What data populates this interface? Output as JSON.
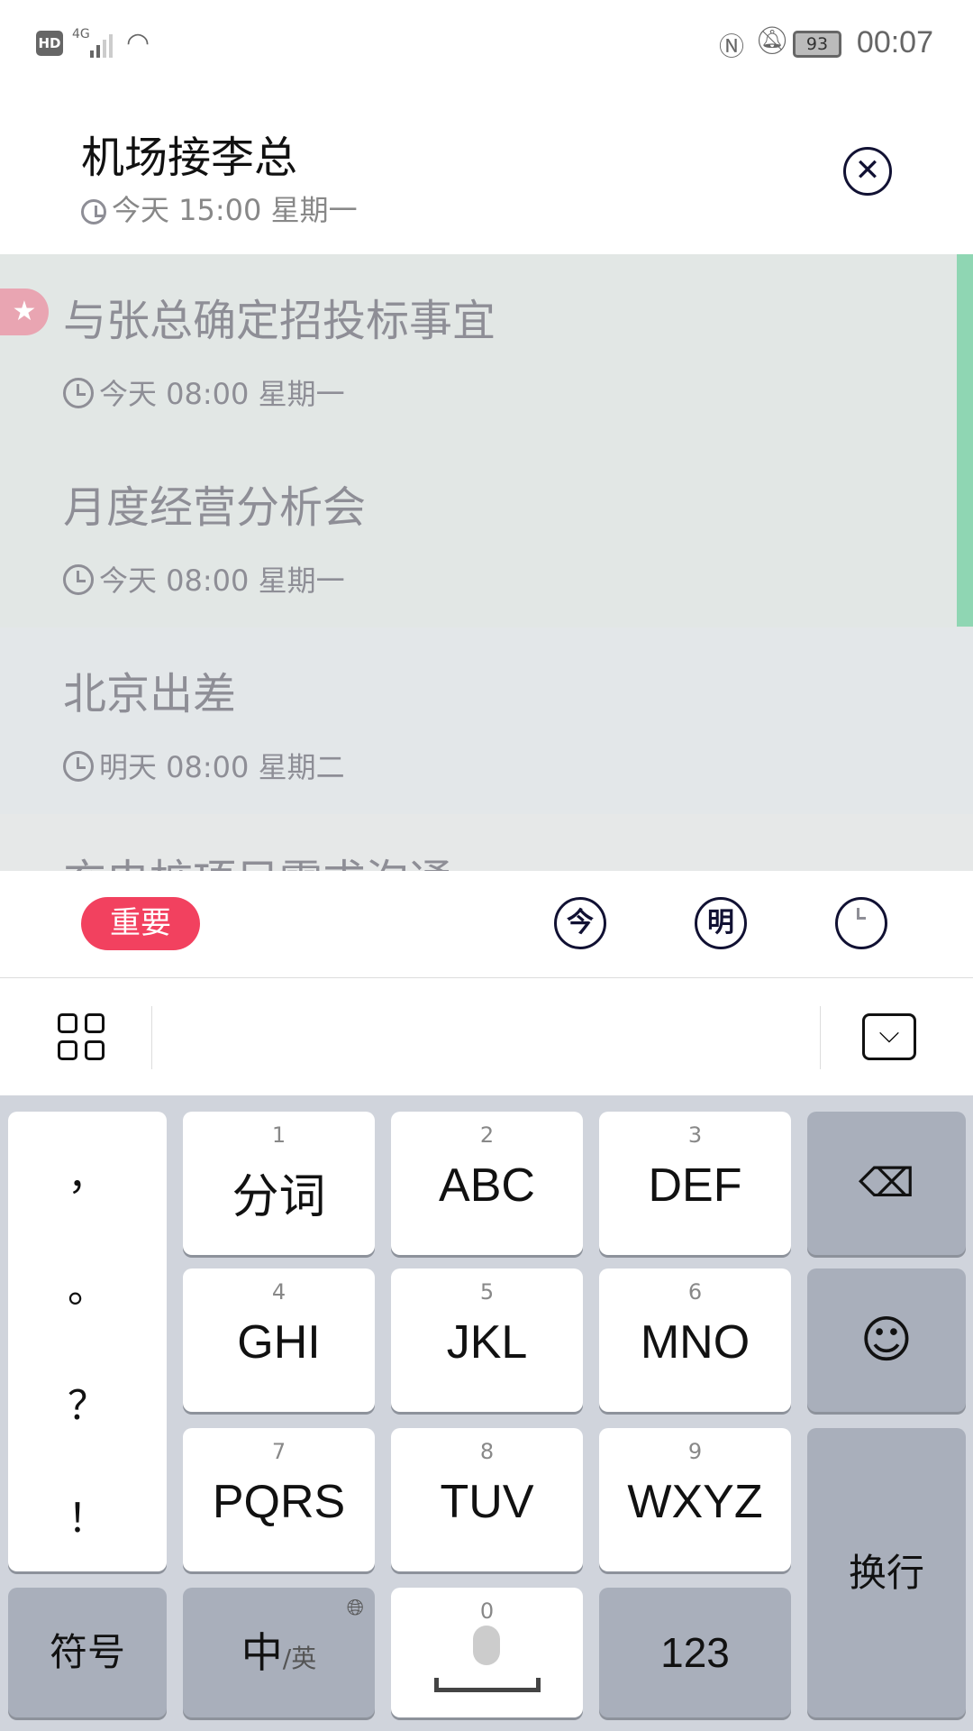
{
  "status_bar": {
    "hd": "HD",
    "network": "4G",
    "battery": "93",
    "time": "00:07"
  },
  "header": {
    "title": "机场接李总",
    "subtitle": "今天 15:00 星期一"
  },
  "list": {
    "items": [
      {
        "title": "与张总确定招投标事宜",
        "time": "今天 08:00 星期一",
        "starred": true
      },
      {
        "title": "月度经营分析会",
        "time": "今天 08:00 星期一"
      },
      {
        "title": "北京出差",
        "time": "明天 08:00 星期二"
      },
      {
        "title": "充电桩项目需求沟通"
      }
    ]
  },
  "toolbar": {
    "important": "重要",
    "today": "今",
    "tomorrow": "明",
    "colors": {
      "important": "#f2415f",
      "accent": "#8fd6b3"
    }
  },
  "keyboard": {
    "punct": [
      "，",
      "。",
      "？",
      "！"
    ],
    "keys": [
      {
        "num": "1",
        "label": "分词"
      },
      {
        "num": "2",
        "label": "ABC"
      },
      {
        "num": "3",
        "label": "DEF"
      },
      {
        "num": "4",
        "label": "GHI"
      },
      {
        "num": "5",
        "label": "JKL"
      },
      {
        "num": "6",
        "label": "MNO"
      },
      {
        "num": "7",
        "label": "PQRS"
      },
      {
        "num": "8",
        "label": "TUV"
      },
      {
        "num": "9",
        "label": "WXYZ"
      }
    ],
    "symbols": "符号",
    "lang_main": "中",
    "lang_alt": "/英",
    "space_num": "0",
    "num_mode": "123",
    "enter": "换行"
  }
}
